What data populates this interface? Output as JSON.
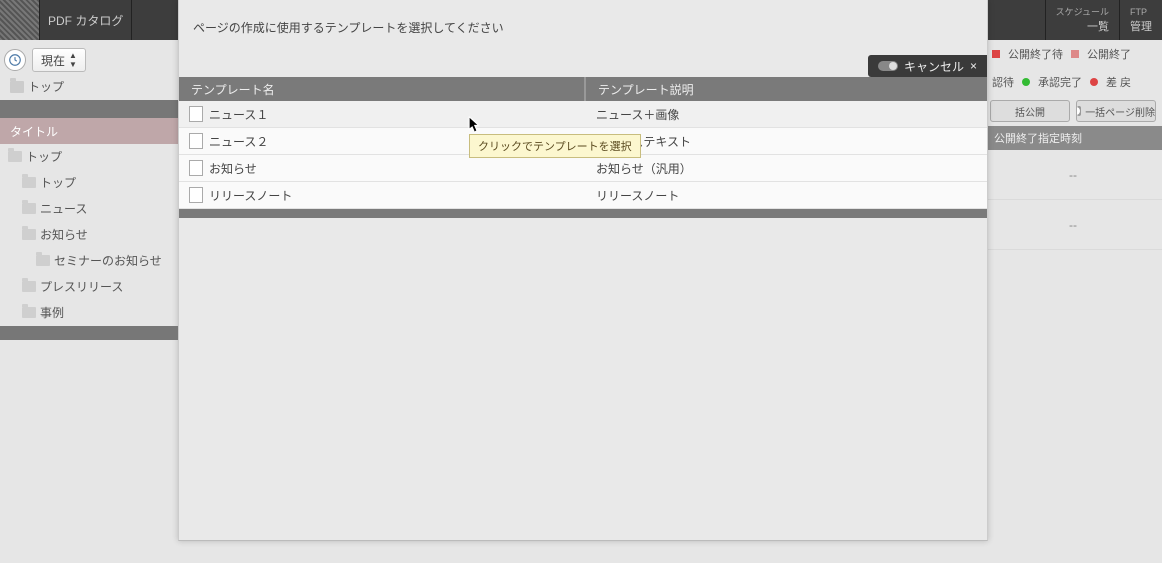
{
  "topbar": {
    "app_title": "PDF カタログ",
    "schedule_label": "スケジュール",
    "schedule_btn": "一覧",
    "ftp_label": "FTP",
    "ftp_btn": "管理"
  },
  "toolbar": {
    "time_label": "現在",
    "fav_label": "トップ"
  },
  "sidebar": {
    "header": "タイトル",
    "items": [
      {
        "label": "トップ",
        "depth": 0
      },
      {
        "label": "トップ",
        "depth": 1
      },
      {
        "label": "ニュース",
        "depth": 1
      },
      {
        "label": "お知らせ",
        "depth": 1
      },
      {
        "label": "セミナーのお知らせ",
        "depth": 2
      },
      {
        "label": "プレスリリース",
        "depth": 1
      },
      {
        "label": "事例",
        "depth": 1
      }
    ]
  },
  "right": {
    "status": {
      "pub_end_wait": "公開終了待",
      "pub_end": "公開終了",
      "approve_wait": "認待",
      "approve_done": "承認完了",
      "returned": "差 戻"
    },
    "btn_bulk_publish": "括公開",
    "btn_bulk_delete": "一括ページ削除",
    "col_header": "公開終了指定時刻",
    "empty": "--"
  },
  "modal": {
    "title": "ページの作成に使用するテンプレートを選択してください",
    "cancel": "キャンセル",
    "col_name": "テンプレート名",
    "col_desc": "テンプレート説明",
    "rows": [
      {
        "name": "ニュース１",
        "desc": "ニュース＋画像"
      },
      {
        "name": "ニュース２",
        "desc": "ニューステキスト"
      },
      {
        "name": "お知らせ",
        "desc": "お知らせ（汎用）"
      },
      {
        "name": "リリースノート",
        "desc": "リリースノート"
      }
    ],
    "tooltip": "クリックでテンプレートを選択"
  }
}
